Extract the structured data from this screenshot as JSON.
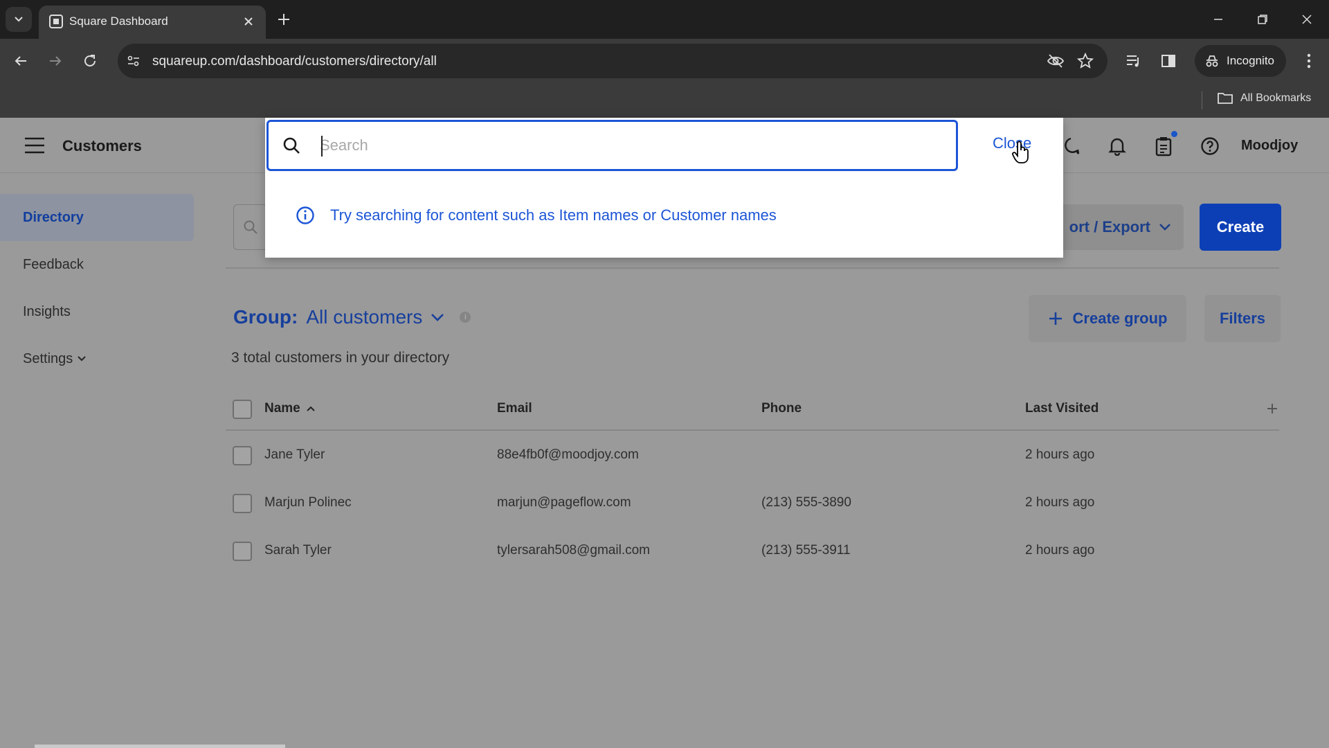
{
  "browser": {
    "tab_title": "Square Dashboard",
    "url": "squareup.com/dashboard/customers/directory/all",
    "profile_label": "Incognito",
    "bookmarks_label": "All Bookmarks"
  },
  "header": {
    "title": "Customers",
    "account_name": "Moodjoy"
  },
  "sidebar": {
    "items": [
      {
        "label": "Directory",
        "active": true
      },
      {
        "label": "Feedback"
      },
      {
        "label": "Insights"
      },
      {
        "label": "Settings"
      }
    ]
  },
  "search_overlay": {
    "placeholder": "Search",
    "value": "",
    "close_label": "Close",
    "hint": "Try searching for content such as Item names or Customer names"
  },
  "actions": {
    "import_export_label": "ort / Export",
    "create_label": "Create",
    "create_group_label": "Create group",
    "filters_label": "Filters"
  },
  "group": {
    "label": "Group:",
    "value": "All customers",
    "total_text": "3 total customers in your directory"
  },
  "table": {
    "columns": [
      "Name",
      "Email",
      "Phone",
      "Last Visited"
    ],
    "rows": [
      {
        "name": "Jane Tyler",
        "email": "88e4fb0f@moodjoy.com",
        "phone": "",
        "last_visited": "2 hours ago"
      },
      {
        "name": "Marjun Polinec",
        "email": "marjun@pageflow.com",
        "phone": "(213) 555-3890",
        "last_visited": "2 hours ago"
      },
      {
        "name": "Sarah Tyler",
        "email": "tylersarah508@gmail.com",
        "phone": "(213) 555-3911",
        "last_visited": "2 hours ago"
      }
    ]
  },
  "colors": {
    "accent": "#1c55d6",
    "primary_button": "#0c3fb5"
  }
}
